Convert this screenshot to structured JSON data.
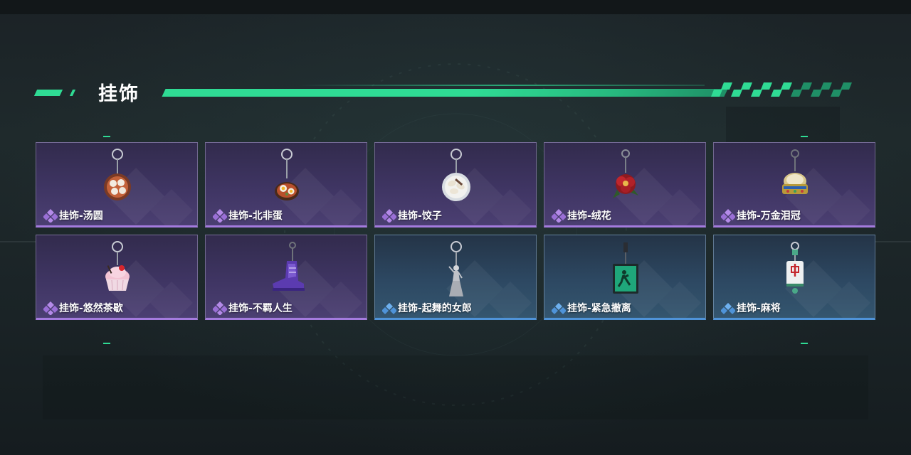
{
  "section": {
    "title": "挂饰"
  },
  "colors": {
    "accent": "#2fdb94",
    "rare_purple": "#a47bde",
    "rare_blue": "#4f93d8"
  },
  "items": [
    {
      "label": "挂饰-汤圆",
      "rarity": "purple",
      "icon": "tangyuan-charm-icon"
    },
    {
      "label": "挂饰-北非蛋",
      "rarity": "purple",
      "icon": "shakshuka-charm-icon"
    },
    {
      "label": "挂饰-饺子",
      "rarity": "purple",
      "icon": "dumplings-charm-icon"
    },
    {
      "label": "挂饰-绒花",
      "rarity": "purple",
      "icon": "velvet-flower-charm-icon"
    },
    {
      "label": "挂饰-万金泪冠",
      "rarity": "purple",
      "icon": "golden-crown-charm-icon"
    },
    {
      "label": "挂饰-悠然茶歇",
      "rarity": "purple",
      "icon": "cupcake-charm-icon"
    },
    {
      "label": "挂饰-不羁人生",
      "rarity": "purple",
      "icon": "sneaker-charm-icon"
    },
    {
      "label": "挂饰-起舞的女郎",
      "rarity": "blue",
      "icon": "dancer-charm-icon"
    },
    {
      "label": "挂饰-紧急撤离",
      "rarity": "blue",
      "icon": "exit-sign-charm-icon"
    },
    {
      "label": "挂饰-麻将",
      "rarity": "blue",
      "icon": "mahjong-tile-charm-icon"
    }
  ]
}
